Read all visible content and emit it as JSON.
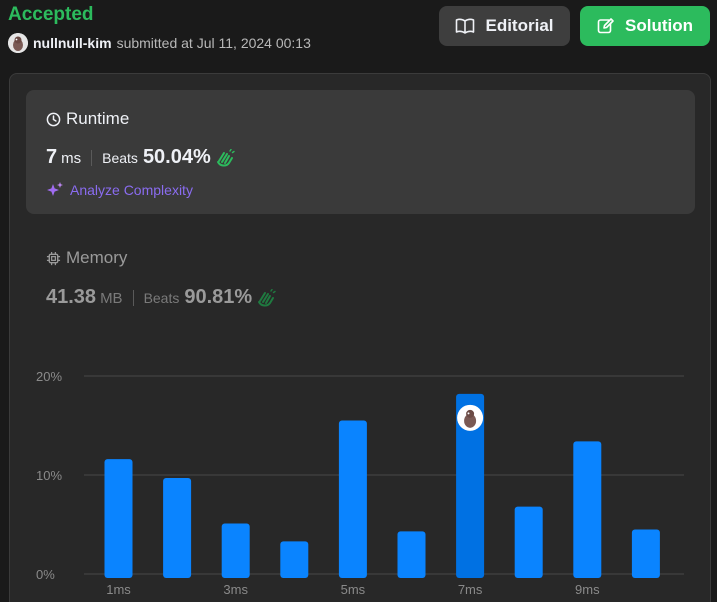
{
  "header": {
    "status": "Accepted",
    "username": "nullnull-kim",
    "submitted_text": "submitted at Jul 11, 2024 00:13",
    "editorial_label": "Editorial",
    "solution_label": "Solution"
  },
  "runtime": {
    "title": "Runtime",
    "value": "7",
    "unit": "ms",
    "beats_label": "Beats",
    "beats_value": "50.04%",
    "analyze_label": "Analyze Complexity"
  },
  "memory": {
    "title": "Memory",
    "value": "41.38",
    "unit": "MB",
    "beats_label": "Beats",
    "beats_value": "90.81%"
  },
  "colors": {
    "accent_green": "#2cbb5d",
    "bar_blue": "#0a84ff",
    "bar_highlight": "#0071e3",
    "analyze_purple": "#8a6cf0"
  },
  "chart_data": {
    "type": "bar",
    "title": "",
    "xlabel": "",
    "ylabel": "",
    "y_ticks": [
      "20%",
      "10%",
      "0%"
    ],
    "ylim": [
      0,
      20
    ],
    "x_tick_labels": [
      "1ms",
      "",
      "3ms",
      "",
      "5ms",
      "",
      "7ms",
      "",
      "9ms",
      ""
    ],
    "values": [
      11.6,
      9.7,
      5.1,
      3.3,
      15.5,
      4.3,
      18.2,
      6.8,
      13.4,
      4.5
    ],
    "highlight_index": 6
  }
}
